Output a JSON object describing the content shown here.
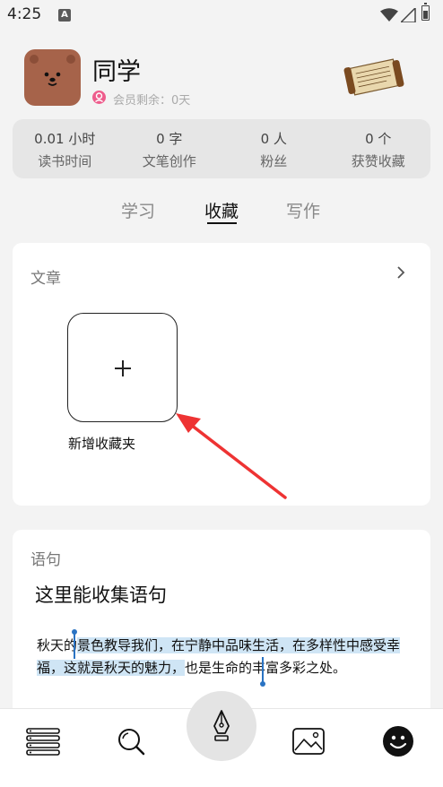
{
  "status_bar": {
    "time": "4:25",
    "notification_letter": "A"
  },
  "profile": {
    "name": "同学",
    "membership": "会员剩余：0天"
  },
  "stats": [
    {
      "value": "0.01 小时",
      "label": "读书时间"
    },
    {
      "value": "0 字",
      "label": "文笔创作"
    },
    {
      "value": "0 人",
      "label": "粉丝"
    },
    {
      "value": "0 个",
      "label": "获赞收藏"
    }
  ],
  "tabs": [
    {
      "label": "学习"
    },
    {
      "label": "收藏"
    },
    {
      "label": "写作"
    }
  ],
  "active_tab": "收藏",
  "articles": {
    "title": "文章",
    "add_folder_label": "新增收藏夹"
  },
  "sentences": {
    "title": "语句",
    "heading": "这里能收集语句",
    "text_before": "秋天的",
    "text_selected": "景色教导我们，在宁静中品味生活，在多样性中感受幸福，这就是秋天的魅力，",
    "text_after": "也是生命的丰富多彩之处。"
  },
  "nav_items": [
    "bookshelf-icon",
    "search-icon",
    "pen-icon",
    "gallery-icon",
    "profile-smiley-icon"
  ],
  "colors": {
    "accent_selection": "#cfe5f5",
    "avatar": "#a6634a",
    "member_badge": "#ee5c8c",
    "annotation_arrow": "#ee3333"
  }
}
